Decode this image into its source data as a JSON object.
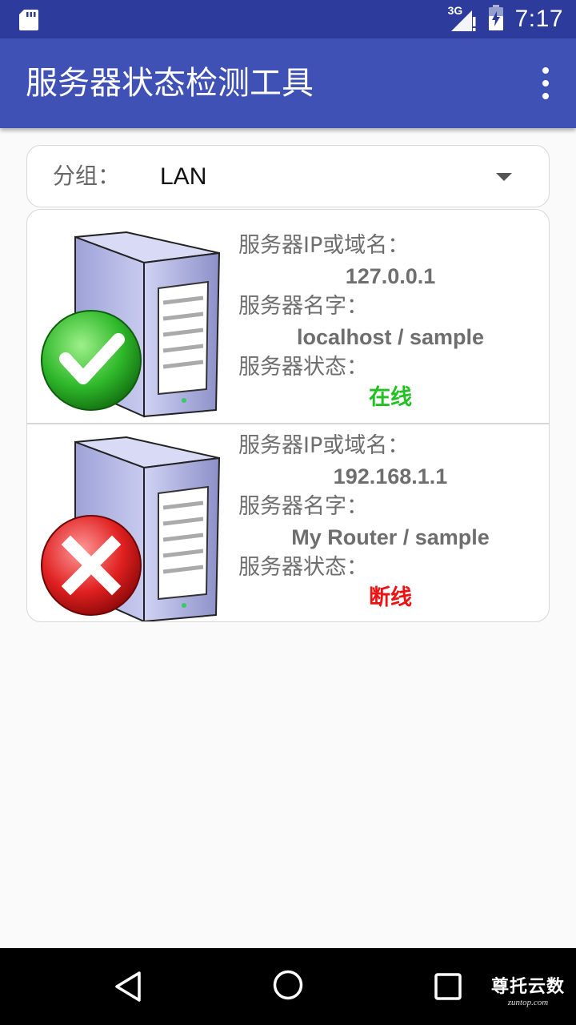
{
  "status_bar": {
    "network": "3G",
    "time": "7:17",
    "icons": [
      "sd-card-icon",
      "signal-icon",
      "battery-icon"
    ]
  },
  "app_bar": {
    "title": "服务器状态检测工具",
    "menu_icon": "overflow-menu-icon"
  },
  "group": {
    "label": "分组：",
    "value": "LAN"
  },
  "servers": [
    {
      "ip_label": "服务器IP或域名：",
      "ip": "127.0.0.1",
      "name_label": "服务器名字：",
      "name": "localhost / sample",
      "status_label": "服务器状态：",
      "status": "在线",
      "status_color": "#22c022",
      "badge_icon": "check-icon"
    },
    {
      "ip_label": "服务器IP或域名：",
      "ip": "192.168.1.1",
      "name_label": "服务器名字：",
      "name": "My Router / sample",
      "status_label": "服务器状态：",
      "status": "断线",
      "status_color": "#ee1111",
      "badge_icon": "cross-icon"
    }
  ],
  "watermark": {
    "main": "尊托云数",
    "sub": "zuntop.com"
  },
  "colors": {
    "primary": "#3f51b5",
    "primary_dark": "#2d3c9c"
  }
}
